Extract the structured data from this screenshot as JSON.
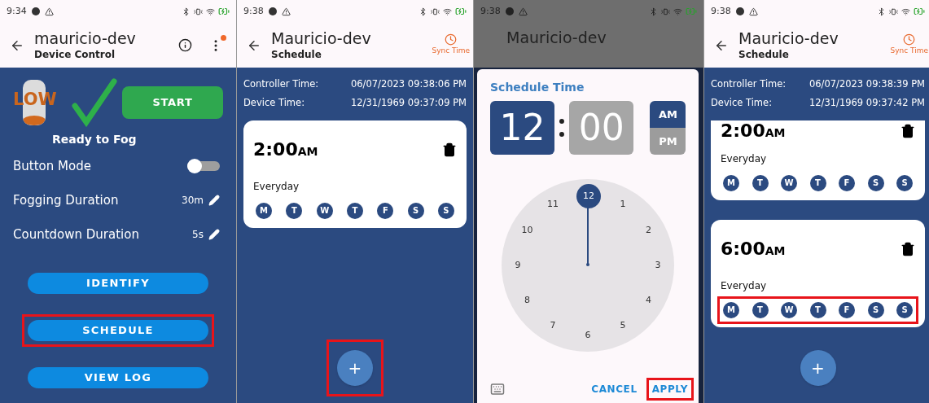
{
  "screens": [
    {
      "kind": "device_control",
      "status_time": "9:34",
      "title": "mauricio-dev",
      "subtitle": "Device Control",
      "notification": true,
      "tank_label": "LOW",
      "start_button": "START",
      "status_text": "Ready to Fog",
      "settings": [
        {
          "kind": "toggle",
          "label": "Button Mode",
          "on": false
        },
        {
          "kind": "value",
          "label": "Fogging Duration",
          "value": "30m"
        },
        {
          "kind": "value",
          "label": "Countdown Duration",
          "value": "5s"
        }
      ],
      "buttons": [
        {
          "label": "IDENTIFY",
          "highlighted": false
        },
        {
          "label": "SCHEDULE",
          "highlighted": true
        },
        {
          "label": "VIEW LOG",
          "highlighted": false
        }
      ]
    },
    {
      "kind": "schedule",
      "status_time": "9:38",
      "title": "Mauricio-dev",
      "subtitle": "Schedule",
      "sync_label": "Sync Time",
      "times": [
        {
          "label": "Controller Time:",
          "value": "06/07/2023 09:38:06 PM"
        },
        {
          "label": "Device Time:",
          "value": "12/31/1969 09:37:09 PM"
        }
      ],
      "schedules": [
        {
          "time": "2:00",
          "period": "AM",
          "repeat": "Everyday",
          "cut_off": false,
          "days_highlighted": false,
          "days": [
            {
              "label": "M",
              "selected": true
            },
            {
              "label": "T",
              "selected": true
            },
            {
              "label": "W",
              "selected": true
            },
            {
              "label": "T",
              "selected": true
            },
            {
              "label": "F",
              "selected": true
            },
            {
              "label": "S",
              "selected": true
            },
            {
              "label": "S",
              "selected": true
            }
          ]
        }
      ],
      "add_button": {
        "label": "+",
        "highlighted": true
      }
    },
    {
      "kind": "time_picker",
      "status_time": "9:38",
      "title": "Mauricio-dev",
      "dialog": {
        "title": "Schedule Time",
        "hour": {
          "value": "12",
          "selected": true
        },
        "minute": {
          "value": "00",
          "selected": false
        },
        "periods": [
          {
            "label": "AM",
            "selected": true
          },
          {
            "label": "PM",
            "selected": false
          }
        ],
        "dial": [
          {
            "label": "12",
            "selected": true
          },
          {
            "label": "1",
            "selected": false
          },
          {
            "label": "2",
            "selected": false
          },
          {
            "label": "3",
            "selected": false
          },
          {
            "label": "4",
            "selected": false
          },
          {
            "label": "5",
            "selected": false
          },
          {
            "label": "6",
            "selected": false
          },
          {
            "label": "7",
            "selected": false
          },
          {
            "label": "8",
            "selected": false
          },
          {
            "label": "9",
            "selected": false
          },
          {
            "label": "10",
            "selected": false
          },
          {
            "label": "11",
            "selected": false
          }
        ],
        "actions": [
          {
            "label": "CANCEL",
            "highlighted": false
          },
          {
            "label": "APPLY",
            "highlighted": true
          }
        ]
      }
    },
    {
      "kind": "schedule",
      "status_time": "9:38",
      "title": "Mauricio-dev",
      "subtitle": "Schedule",
      "sync_label": "Sync Time",
      "times": [
        {
          "label": "Controller Time:",
          "value": "06/07/2023 09:38:39 PM"
        },
        {
          "label": "Device Time:",
          "value": "12/31/1969 09:37:42 PM"
        }
      ],
      "schedules": [
        {
          "time": "2:00",
          "period": "AM",
          "repeat": "Everyday",
          "cut_off": true,
          "days_highlighted": false,
          "days": [
            {
              "label": "M",
              "selected": true
            },
            {
              "label": "T",
              "selected": true
            },
            {
              "label": "W",
              "selected": true
            },
            {
              "label": "T",
              "selected": true
            },
            {
              "label": "F",
              "selected": true
            },
            {
              "label": "S",
              "selected": true
            },
            {
              "label": "S",
              "selected": true
            }
          ]
        },
        {
          "time": "6:00",
          "period": "AM",
          "repeat": "Everyday",
          "cut_off": false,
          "days_highlighted": true,
          "days": [
            {
              "label": "M",
              "selected": true
            },
            {
              "label": "T",
              "selected": true
            },
            {
              "label": "W",
              "selected": true
            },
            {
              "label": "T",
              "selected": true
            },
            {
              "label": "F",
              "selected": true
            },
            {
              "label": "S",
              "selected": true
            },
            {
              "label": "S",
              "selected": true
            }
          ]
        }
      ],
      "add_button": {
        "label": "+",
        "highlighted": false
      }
    }
  ]
}
